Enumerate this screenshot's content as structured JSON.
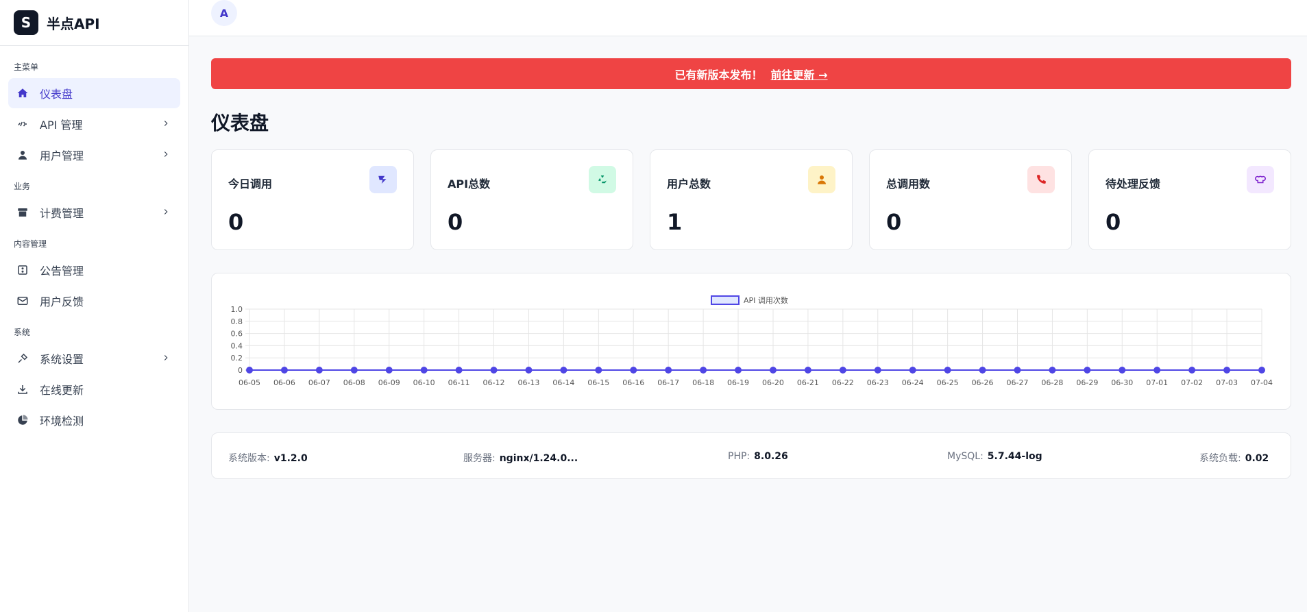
{
  "brand": {
    "logo_letter": "S",
    "name": "半点API"
  },
  "avatar": {
    "letter": "A"
  },
  "sidebar": {
    "sections": [
      {
        "title": "主菜单",
        "items": [
          {
            "label": "仪表盘",
            "icon": "home-icon",
            "active": true,
            "expandable": false
          },
          {
            "label": "API 管理",
            "icon": "code-icon",
            "active": false,
            "expandable": true
          },
          {
            "label": "用户管理",
            "icon": "user-icon",
            "active": false,
            "expandable": true
          }
        ]
      },
      {
        "title": "业务",
        "items": [
          {
            "label": "计费管理",
            "icon": "archive-icon",
            "active": false,
            "expandable": true
          }
        ]
      },
      {
        "title": "内容管理",
        "items": [
          {
            "label": "公告管理",
            "icon": "notice-icon",
            "active": false,
            "expandable": false
          },
          {
            "label": "用户反馈",
            "icon": "mail-icon",
            "active": false,
            "expandable": false
          }
        ]
      },
      {
        "title": "系统",
        "items": [
          {
            "label": "系统设置",
            "icon": "settings-icon",
            "active": false,
            "expandable": true
          },
          {
            "label": "在线更新",
            "icon": "download-icon",
            "active": false,
            "expandable": false
          },
          {
            "label": "环境检测",
            "icon": "pie-chart-icon",
            "active": false,
            "expandable": false
          }
        ]
      }
    ]
  },
  "banner": {
    "text": "已有新版本发布！",
    "link": "前往更新 →",
    "color": "#ef4444"
  },
  "page_title": "仪表盘",
  "stats": [
    {
      "label": "今日调用",
      "value": "0",
      "icon": "plane-icon",
      "bg": "#e0e7ff",
      "fg": "#4338ca"
    },
    {
      "label": "API总数",
      "value": "0",
      "icon": "recycle-icon",
      "bg": "#d1fae5",
      "fg": "#059669"
    },
    {
      "label": "用户总数",
      "value": "1",
      "icon": "user-icon",
      "bg": "#fef3c7",
      "fg": "#d97706"
    },
    {
      "label": "总调用数",
      "value": "0",
      "icon": "phone-icon",
      "bg": "#fee2e2",
      "fg": "#dc2626"
    },
    {
      "label": "待处理反馈",
      "value": "0",
      "icon": "chef-hat-icon",
      "bg": "#f3e8ff",
      "fg": "#7e22ce"
    }
  ],
  "chart_data": {
    "type": "line",
    "legend": "API 调用次数",
    "x": [
      "06-05",
      "06-06",
      "06-07",
      "06-08",
      "06-09",
      "06-10",
      "06-11",
      "06-12",
      "06-13",
      "06-14",
      "06-15",
      "06-16",
      "06-17",
      "06-18",
      "06-19",
      "06-20",
      "06-21",
      "06-22",
      "06-23",
      "06-24",
      "06-25",
      "06-26",
      "06-27",
      "06-28",
      "06-29",
      "06-30",
      "07-01",
      "07-02",
      "07-03",
      "07-04"
    ],
    "series": [
      {
        "name": "API 调用次数",
        "values": [
          0,
          0,
          0,
          0,
          0,
          0,
          0,
          0,
          0,
          0,
          0,
          0,
          0,
          0,
          0,
          0,
          0,
          0,
          0,
          0,
          0,
          0,
          0,
          0,
          0,
          0,
          0,
          0,
          0,
          0
        ]
      }
    ],
    "yticks": [
      "0",
      "0.2",
      "0.4",
      "0.6",
      "0.8",
      "1.0"
    ],
    "ylim": [
      0,
      1
    ],
    "grid": true,
    "legend_position": "top-center",
    "color": "#4f46e5"
  },
  "system_info": [
    {
      "label": "系统版本:",
      "value": "v1.2.0"
    },
    {
      "label": "服务器:",
      "value": "nginx/1.24.0..."
    },
    {
      "label": "PHP:",
      "value": "8.0.26"
    },
    {
      "label": "MySQL:",
      "value": "5.7.44-log"
    },
    {
      "label": "系统负载:",
      "value": "0.02"
    }
  ]
}
